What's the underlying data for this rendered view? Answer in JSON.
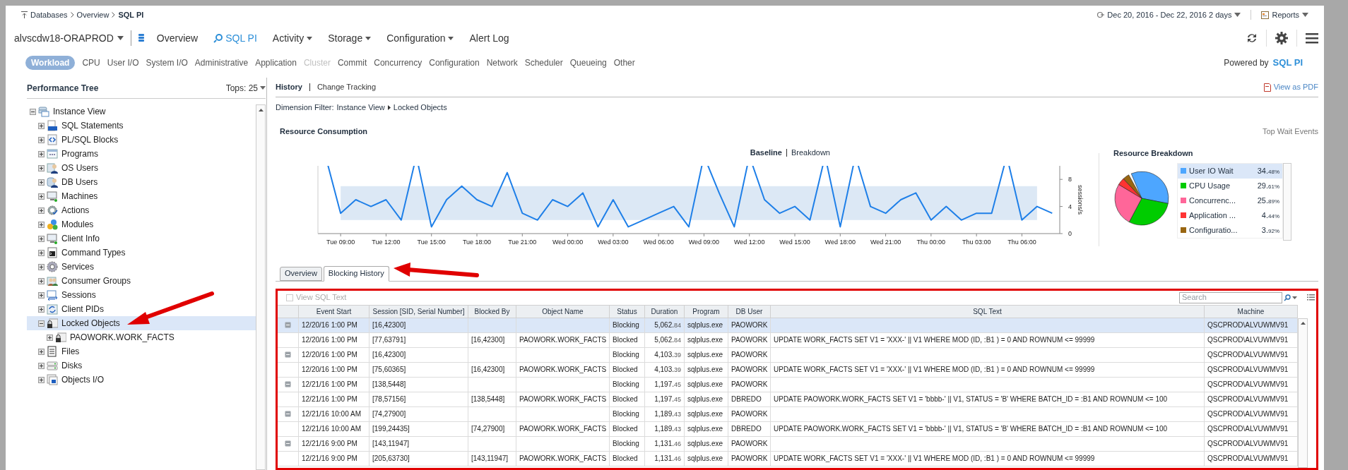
{
  "breadcrumb": [
    {
      "label": "Databases",
      "current": false
    },
    {
      "label": "Overview",
      "current": false
    },
    {
      "label": "SQL PI",
      "current": true
    }
  ],
  "date_range": "Dec 20, 2016 - Dec 22, 2016 2 days",
  "reports": "Reports",
  "instance": "alvscdw18-ORAPROD",
  "nav": [
    {
      "label": "Overview",
      "selected": false,
      "dropdown": false
    },
    {
      "label": "SQL PI",
      "selected": true,
      "dropdown": false
    },
    {
      "label": "Activity",
      "selected": false,
      "dropdown": true
    },
    {
      "label": "Storage",
      "selected": false,
      "dropdown": true
    },
    {
      "label": "Configuration",
      "selected": false,
      "dropdown": true
    },
    {
      "label": "Alert Log",
      "selected": false,
      "dropdown": false
    }
  ],
  "categories": [
    {
      "label": "Workload",
      "selected": true,
      "disabled": false
    },
    {
      "label": "CPU",
      "selected": false,
      "disabled": false
    },
    {
      "label": "User I/O",
      "selected": false,
      "disabled": false
    },
    {
      "label": "System I/O",
      "selected": false,
      "disabled": false
    },
    {
      "label": "Administrative",
      "selected": false,
      "disabled": false
    },
    {
      "label": "Application",
      "selected": false,
      "disabled": false
    },
    {
      "label": "Cluster",
      "selected": false,
      "disabled": true
    },
    {
      "label": "Commit",
      "selected": false,
      "disabled": false
    },
    {
      "label": "Concurrency",
      "selected": false,
      "disabled": false
    },
    {
      "label": "Configuration",
      "selected": false,
      "disabled": false
    },
    {
      "label": "Network",
      "selected": false,
      "disabled": false
    },
    {
      "label": "Scheduler",
      "selected": false,
      "disabled": false
    },
    {
      "label": "Queueing",
      "selected": false,
      "disabled": false
    },
    {
      "label": "Other",
      "selected": false,
      "disabled": false
    }
  ],
  "powered_by": {
    "label": "Powered by",
    "logo": "SQL PI"
  },
  "tree_panel": {
    "title": "Performance Tree",
    "tops": "Tops: 25",
    "items": [
      {
        "label": "Instance View",
        "expanded": true,
        "selected": false,
        "children": [
          {
            "label": "SQL Statements",
            "expanded": false,
            "selected": false
          },
          {
            "label": "PL/SQL Blocks",
            "expanded": false,
            "selected": false
          },
          {
            "label": "Programs",
            "expanded": false,
            "selected": false
          },
          {
            "label": "OS Users",
            "expanded": false,
            "selected": false
          },
          {
            "label": "DB Users",
            "expanded": false,
            "selected": false
          },
          {
            "label": "Machines",
            "expanded": false,
            "selected": false
          },
          {
            "label": "Actions",
            "expanded": false,
            "selected": false
          },
          {
            "label": "Modules",
            "expanded": false,
            "selected": false
          },
          {
            "label": "Client Info",
            "expanded": false,
            "selected": false
          },
          {
            "label": "Command Types",
            "expanded": false,
            "selected": false
          },
          {
            "label": "Services",
            "expanded": false,
            "selected": false
          },
          {
            "label": "Consumer Groups",
            "expanded": false,
            "selected": false
          },
          {
            "label": "Sessions",
            "expanded": false,
            "selected": false
          },
          {
            "label": "Client PIDs",
            "expanded": false,
            "selected": false
          },
          {
            "label": "Locked Objects",
            "expanded": true,
            "selected": true,
            "children": [
              {
                "label": "PAOWORK.WORK_FACTS",
                "expanded": false,
                "selected": false
              }
            ]
          },
          {
            "label": "Files",
            "expanded": false,
            "selected": false
          },
          {
            "label": "Disks",
            "expanded": false,
            "selected": false
          },
          {
            "label": "Objects I/O",
            "expanded": false,
            "selected": false
          }
        ]
      }
    ]
  },
  "view_tabs": [
    {
      "label": "History",
      "selected": true
    },
    {
      "label": "Change Tracking",
      "selected": false
    }
  ],
  "view_as_pdf": "View as PDF",
  "dimension_filter": {
    "label": "Dimension Filter:",
    "path": [
      "Instance View",
      "Locked Objects"
    ]
  },
  "resource_consumption": {
    "title": "Resource Consumption",
    "top_wait_events": "Top Wait Events",
    "modes": [
      {
        "label": "Baseline",
        "selected": true
      },
      {
        "label": "Breakdown",
        "selected": false
      }
    ],
    "chart_data": {
      "type": "line",
      "ylabel": "sessions/s",
      "ylim": [
        0,
        10
      ],
      "categories": [
        null,
        "Tue 09:00",
        null,
        null,
        "Tue 12:00",
        null,
        null,
        "Tue 15:00",
        null,
        null,
        "Tue 18:00",
        null,
        null,
        "Tue 21:00",
        null,
        null,
        "Wed 00:00",
        null,
        null,
        "Wed 03:00",
        null,
        null,
        "Wed 06:00",
        null,
        null,
        "Wed 09:00",
        null,
        null,
        "Wed 12:00",
        null,
        null,
        "Wed 15:00",
        null,
        null,
        "Wed 18:00",
        null,
        null,
        "Wed 21:00",
        null,
        null,
        "Thu 00:00",
        null,
        null,
        "Thu 03:00",
        null,
        null,
        "Thu 06:00",
        null,
        null
      ],
      "yticks": [
        0,
        4,
        8
      ],
      "bands": [
        {
          "axis": "y",
          "from": 2,
          "to": 7,
          "color": "#dce8f5"
        }
      ],
      "series": [
        {
          "color": "#1e7fe8",
          "values": [
            null,
            3,
            5,
            4,
            5,
            2,
            null,
            1,
            5,
            7,
            5,
            4,
            9,
            3,
            2,
            5,
            4,
            6,
            1,
            5,
            1,
            2,
            3,
            4,
            1,
            null,
            6,
            1,
            null,
            5,
            3,
            4,
            2,
            null,
            1,
            null,
            4,
            3,
            5,
            6,
            2,
            4,
            2,
            3,
            3,
            null,
            2,
            4,
            3
          ]
        }
      ]
    }
  },
  "resource_breakdown": {
    "title": "Resource Breakdown",
    "chart_data": {
      "type": "pie",
      "categories": [
        "User IO Wait",
        "CPU Usage",
        "Concurrenc...",
        "Application ...",
        "Configuratio..."
      ],
      "series": [
        {
          "values": [
            34.48,
            29.61,
            25.89,
            4.44,
            3.92
          ]
        }
      ]
    },
    "legend": [
      {
        "percent": "34.48%",
        "color": "#4da6ff",
        "selected": true
      },
      {
        "percent": "29.61%",
        "color": "#00cc00",
        "selected": false
      },
      {
        "percent": "25.89%",
        "color": "#ff6699",
        "selected": false
      },
      {
        "percent": "4.44%",
        "color": "#ff3333",
        "selected": false
      },
      {
        "percent": "3.92%",
        "color": "#996611",
        "selected": false
      }
    ]
  },
  "sub_tabs": [
    {
      "label": "Overview",
      "selected": false
    },
    {
      "label": "Blocking History",
      "selected": true
    }
  ],
  "table": {
    "view_sql_text": {
      "label": "View SQL Text",
      "checked": false,
      "disabled": true
    },
    "search": {
      "placeholder": "Search"
    },
    "columns": [
      "Event Start",
      "Session [SID, Serial Number]",
      "Blocked By",
      "Object Name",
      "Status",
      "Duration",
      "Program",
      "DB User",
      "SQL Text",
      "Machine"
    ],
    "rows": [
      {
        "event_start": "12/20/16 1:00 PM",
        "session": "[16,42300]",
        "status": "Blocking",
        "duration": "5,062.84",
        "program": "sqlplus.exe",
        "db_user": "PAOWORK",
        "machine": "QSCPROD\\ALVUWMV91",
        "expanded": true,
        "selected": true,
        "children": [
          {
            "event_start": "12/20/16 1:00 PM",
            "session": "[77,63791]",
            "blocked_by": "[16,42300]",
            "object_name": "PAOWORK.WORK_FACTS",
            "status": "Blocked",
            "duration": "5,062.84",
            "program": "sqlplus.exe",
            "db_user": "PAOWORK",
            "sql_text": "UPDATE WORK_FACTS SET V1 = 'XXX-' || V1 WHERE MOD (ID, :B1 ) = 0 AND ROWNUM <= 99999",
            "machine": "QSCPROD\\ALVUWMV91",
            "selected": false
          }
        ]
      },
      {
        "event_start": "12/20/16 1:00 PM",
        "session": "[16,42300]",
        "status": "Blocking",
        "duration": "4,103.39",
        "program": "sqlplus.exe",
        "db_user": "PAOWORK",
        "machine": "QSCPROD\\ALVUWMV91",
        "expanded": true,
        "selected": false,
        "children": [
          {
            "event_start": "12/20/16 1:00 PM",
            "session": "[75,60365]",
            "blocked_by": "[16,42300]",
            "object_name": "PAOWORK.WORK_FACTS",
            "status": "Blocked",
            "duration": "4,103.39",
            "program": "sqlplus.exe",
            "db_user": "PAOWORK",
            "sql_text": "UPDATE WORK_FACTS SET V1 = 'XXX-' || V1 WHERE MOD (ID, :B1 ) = 0 AND ROWNUM <= 99999",
            "machine": "QSCPROD\\ALVUWMV91",
            "selected": false
          }
        ]
      },
      {
        "event_start": "12/21/16 1:00 PM",
        "session": "[138,5448]",
        "status": "Blocking",
        "duration": "1,197.45",
        "program": "sqlplus.exe",
        "db_user": "PAOWORK",
        "machine": "QSCPROD\\ALVUWMV91",
        "expanded": true,
        "selected": false,
        "children": [
          {
            "event_start": "12/21/16 1:00 PM",
            "session": "[78,57156]",
            "blocked_by": "[138,5448]",
            "object_name": "PAOWORK.WORK_FACTS",
            "status": "Blocked",
            "duration": "1,197.45",
            "program": "sqlplus.exe",
            "db_user": "DBREDO",
            "sql_text": "UPDATE PAOWORK.WORK_FACTS SET V1 = 'bbbb-' || V1, STATUS = 'B' WHERE BATCH_ID = :B1 AND ROWNUM <= 100",
            "machine": "QSCPROD\\ALVUWMV91",
            "selected": false
          }
        ]
      },
      {
        "event_start": "12/21/16 10:00 AM",
        "session": "[74,27900]",
        "status": "Blocking",
        "duration": "1,189.43",
        "program": "sqlplus.exe",
        "db_user": "PAOWORK",
        "machine": "QSCPROD\\ALVUWMV91",
        "expanded": true,
        "selected": false,
        "children": [
          {
            "event_start": "12/21/16 10:00 AM",
            "session": "[199,24435]",
            "blocked_by": "[74,27900]",
            "object_name": "PAOWORK.WORK_FACTS",
            "status": "Blocked",
            "duration": "1,189.43",
            "program": "sqlplus.exe",
            "db_user": "DBREDO",
            "sql_text": "UPDATE PAOWORK.WORK_FACTS SET V1 = 'bbbb-' || V1, STATUS = 'B' WHERE BATCH_ID = :B1 AND ROWNUM <= 100",
            "machine": "QSCPROD\\ALVUWMV91",
            "selected": false
          }
        ]
      },
      {
        "event_start": "12/21/16 9:00 PM",
        "session": "[143,11947]",
        "status": "Blocking",
        "duration": "1,131.46",
        "program": "sqlplus.exe",
        "db_user": "PAOWORK",
        "machine": "QSCPROD\\ALVUWMV91",
        "expanded": true,
        "selected": false,
        "children": [
          {
            "event_start": "12/21/16 9:00 PM",
            "session": "[205,63730]",
            "blocked_by": "[143,11947]",
            "object_name": "PAOWORK.WORK_FACTS",
            "status": "Blocked",
            "duration": "1,131.46",
            "program": "sqlplus.exe",
            "db_user": "PAOWORK",
            "sql_text": "UPDATE WORK_FACTS SET V1 = 'XXX-' || V1 WHERE MOD (ID, :B1 ) = 0 AND ROWNUM <= 99999",
            "machine": "QSCPROD\\ALVUWMV91",
            "selected": false
          }
        ]
      }
    ]
  }
}
